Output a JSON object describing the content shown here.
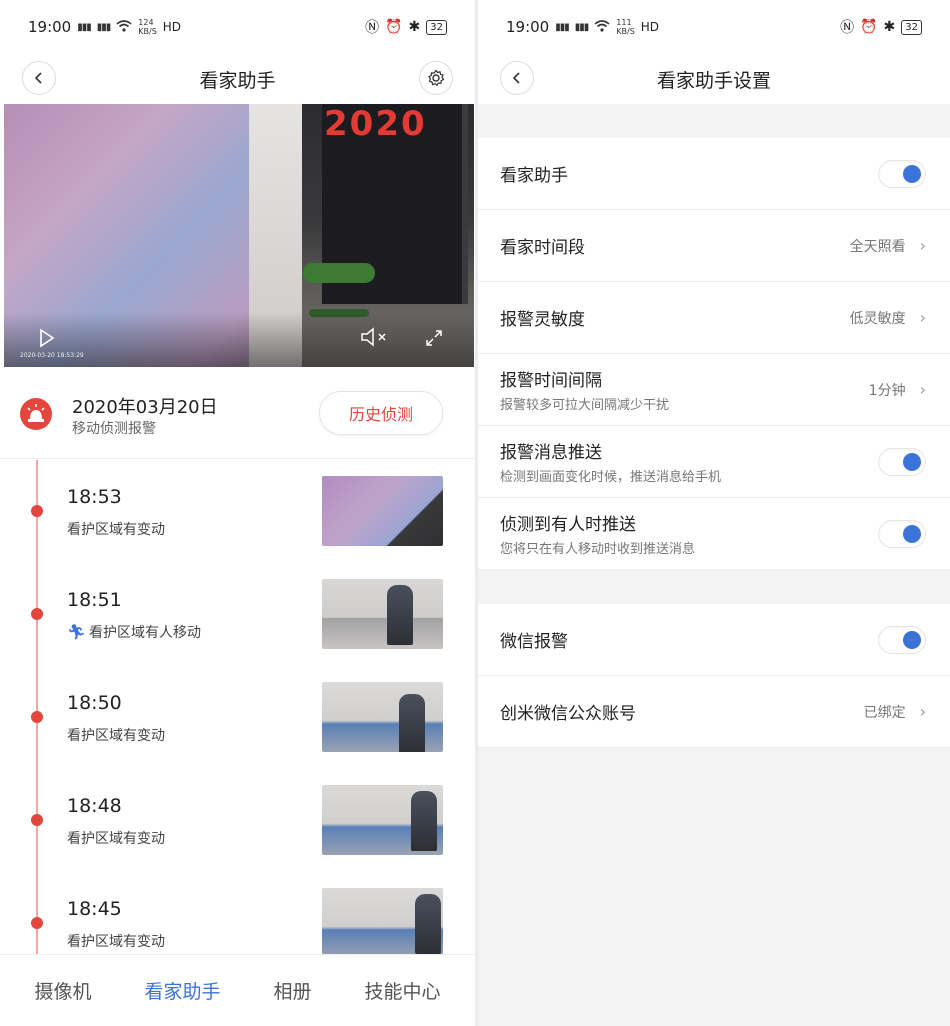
{
  "status": {
    "left": {
      "time": "19:00",
      "signal1": "4G",
      "signal2": "4G",
      "speed": "124\nKB/S",
      "hd": "HD"
    },
    "right": {
      "time": "19:00",
      "signal1": "4G",
      "signal2": "4G",
      "speed": "111\nKB/S",
      "hd": "HD"
    },
    "battery": "32"
  },
  "left": {
    "title": "看家助手",
    "video": {
      "timestamp": "2020-03-20 18:53:29",
      "deco_text": "2020"
    },
    "alarm": {
      "date": "2020年03月20日",
      "subtitle": "移动侦测报警",
      "history_button": "历史侦测"
    },
    "timeline": [
      {
        "time": "18:53",
        "desc": "看护区域有变动",
        "person": false
      },
      {
        "time": "18:51",
        "desc": "看护区域有人移动",
        "person": true
      },
      {
        "time": "18:50",
        "desc": "看护区域有变动",
        "person": false
      },
      {
        "time": "18:48",
        "desc": "看护区域有变动",
        "person": false
      },
      {
        "time": "18:45",
        "desc": "看护区域有变动",
        "person": false
      }
    ],
    "tabs": [
      {
        "label": "摄像机",
        "active": false
      },
      {
        "label": "看家助手",
        "active": true
      },
      {
        "label": "相册",
        "active": false
      },
      {
        "label": "技能中心",
        "active": false
      }
    ]
  },
  "right": {
    "title": "看家助手设置",
    "group1": [
      {
        "label": "看家助手",
        "type": "toggle",
        "on": true
      },
      {
        "label": "看家时间段",
        "type": "value",
        "value": "全天照看"
      },
      {
        "label": "报警灵敏度",
        "type": "value",
        "value": "低灵敏度"
      },
      {
        "label": "报警时间间隔",
        "sub": "报警较多可拉大间隔减少干扰",
        "type": "value",
        "value": "1分钟"
      },
      {
        "label": "报警消息推送",
        "sub": "检测到画面变化时候，推送消息给手机",
        "type": "toggle",
        "on": true
      },
      {
        "label": "侦测到有人时推送",
        "sub": "您将只在有人移动时收到推送消息",
        "type": "toggle",
        "on": true
      }
    ],
    "group2": [
      {
        "label": "微信报警",
        "type": "toggle",
        "on": true
      },
      {
        "label": "创米微信公众账号",
        "type": "value",
        "value": "已绑定"
      }
    ]
  },
  "colors": {
    "accent_blue": "#3c73d8",
    "alarm_red": "#e4463e",
    "timeline_line": "#f2a7a3"
  }
}
